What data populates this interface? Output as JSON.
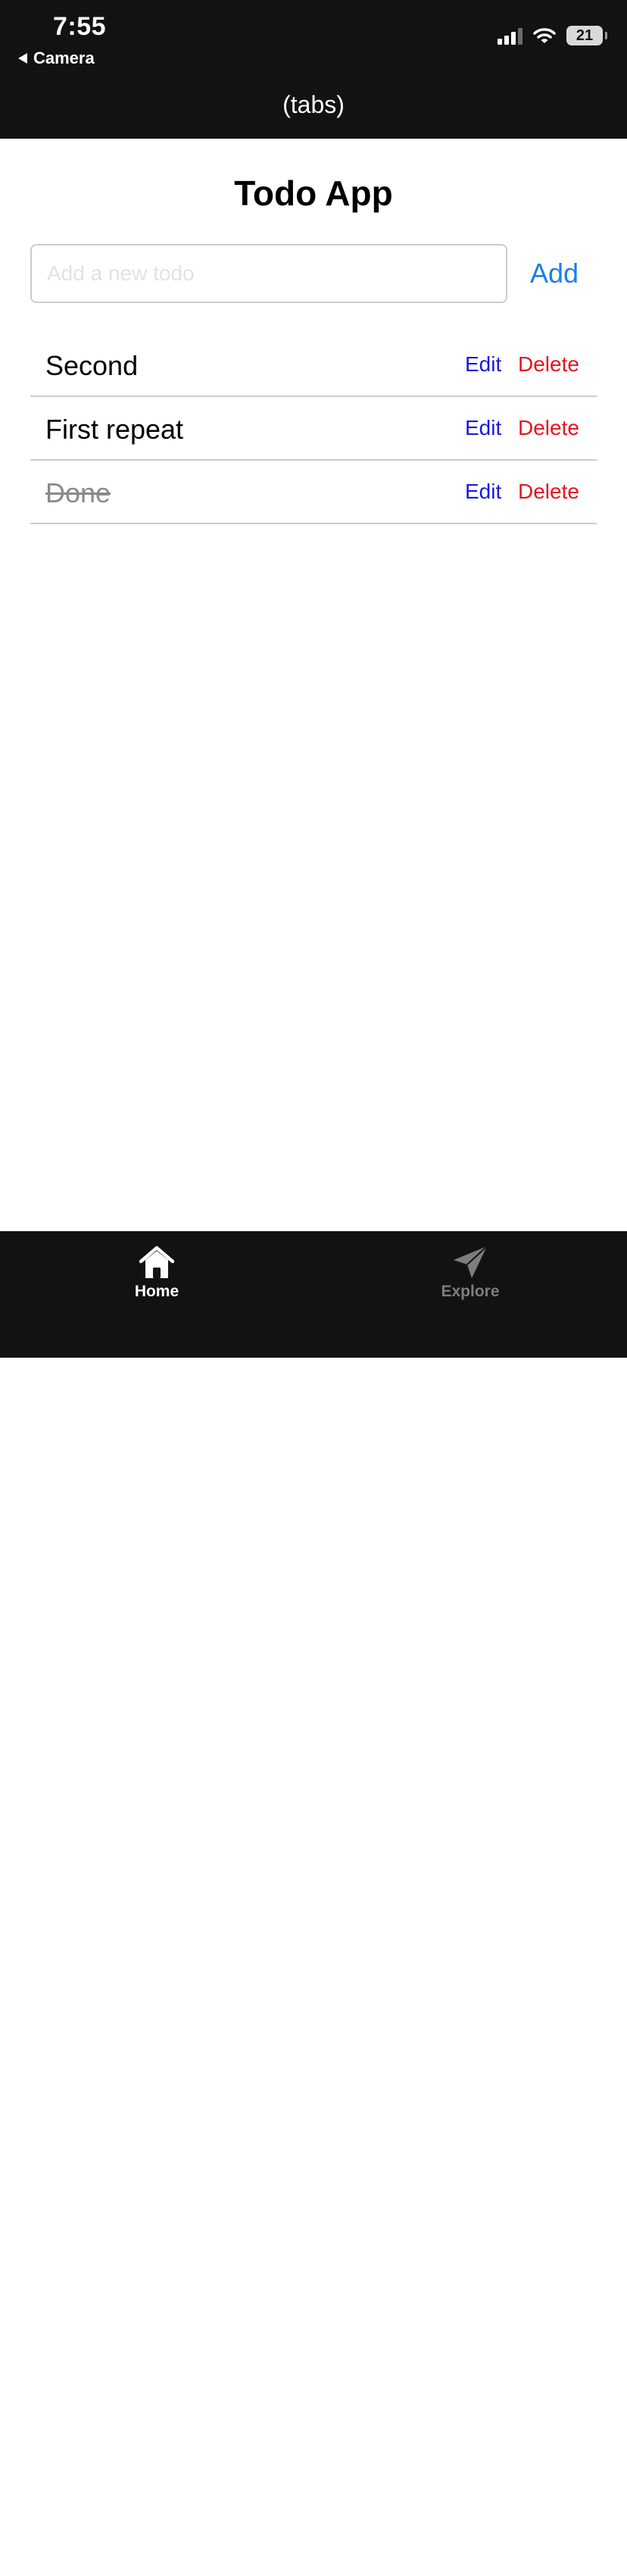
{
  "status_bar": {
    "time": "7:55",
    "back_app": "Camera",
    "battery": "21",
    "icons": [
      "back-arrow-icon",
      "signal-icon",
      "wifi-icon",
      "battery-icon"
    ]
  },
  "nav": {
    "title": "(tabs)"
  },
  "app": {
    "title": "Todo App",
    "input": {
      "value": "",
      "placeholder": "Add a new todo"
    },
    "add_label": "Add",
    "todos": [
      {
        "text": "Second",
        "completed": false,
        "edit_label": "Edit",
        "delete_label": "Delete"
      },
      {
        "text": "First repeat",
        "completed": false,
        "edit_label": "Edit",
        "delete_label": "Delete"
      },
      {
        "text": "Done",
        "completed": true,
        "edit_label": "Edit",
        "delete_label": "Delete"
      }
    ]
  },
  "tabs": [
    {
      "label": "Home",
      "icon": "home-icon",
      "active": true
    },
    {
      "label": "Explore",
      "icon": "paper-plane-icon",
      "active": false
    }
  ],
  "colors": {
    "header_bg": "#121212",
    "add_blue": "#1a7fe8",
    "edit_blue": "#1a1ae0",
    "delete_red": "#e8141e",
    "done_gray": "#8a8a8a",
    "tab_inactive": "#7d7d7d"
  }
}
